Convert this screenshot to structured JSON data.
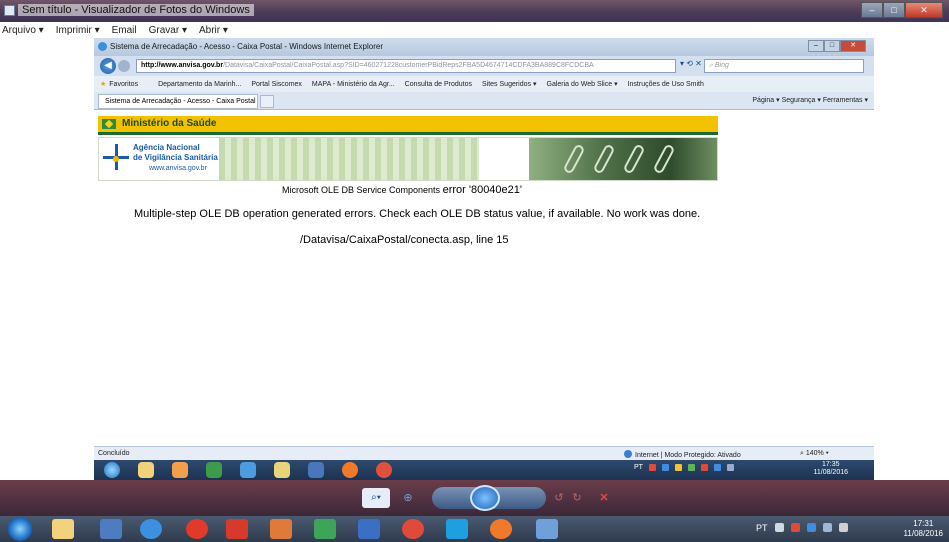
{
  "viewer": {
    "title": "Sem título - Visualizador de Fotos do Windows",
    "menu": [
      "Arquivo ▾",
      "Imprimir ▾",
      "Email",
      "Gravar ▾",
      "Abrir ▾"
    ],
    "window_controls": [
      "–",
      "□",
      "✕"
    ]
  },
  "ie": {
    "title": "Sistema de Arrecadação - Acesso - Caixa Postal - Windows Internet Explorer",
    "url_host": "http://www.anvisa.gov.br",
    "url_rest": "/Datavisa/CaixaPostal/CaixaPostal.asp?SID=460271228customerPBidReps2FBA5D4674714CDFA3BA889C8FCDCBA",
    "search_placeholder": "Bing",
    "favorites": [
      "Favoritos",
      "Departamento da Marinh...",
      "Portal Siscomex",
      "MAPA - Ministério da Agr...",
      "Consulta de Produtos",
      "Sites Sugeridos ▾",
      "Galeria do Web Slice ▾",
      "Instruções de Uso Smith"
    ],
    "tab_label": "Sistema de Arrecadação - Acesso - Caixa Postal",
    "command_bar": "Página ▾  Segurança ▾  Ferramentas ▾",
    "status_left": "Concluído",
    "status_zone": "Internet | Modo Protegido: Ativado",
    "status_zoom": "140% ▾",
    "inner_clock_time": "17:35",
    "inner_clock_date": "11/08/2016"
  },
  "page": {
    "ms_header": "Ministério da Saúde",
    "anvisa_name1": "Agência Nacional",
    "anvisa_name2": "de Vigilância Sanitária",
    "anvisa_site": "www.anvisa.gov.br",
    "error_source": "Microsoft OLE DB Service Components",
    "error_code": "error '80040e21'",
    "error_message": "Multiple-step OLE DB operation generated errors. Check each OLE DB status value, if available. No work was done.",
    "error_location": "/Datavisa/CaixaPostal/conecta.asp, line 15"
  },
  "os": {
    "lang": "PT",
    "clock_time": "17:31",
    "clock_date": "11/08/2016"
  },
  "colors": {
    "ms_yellow": "#f2c200",
    "anvisa_blue": "#1a5ba3",
    "taskbar": "#2f3b4e"
  }
}
